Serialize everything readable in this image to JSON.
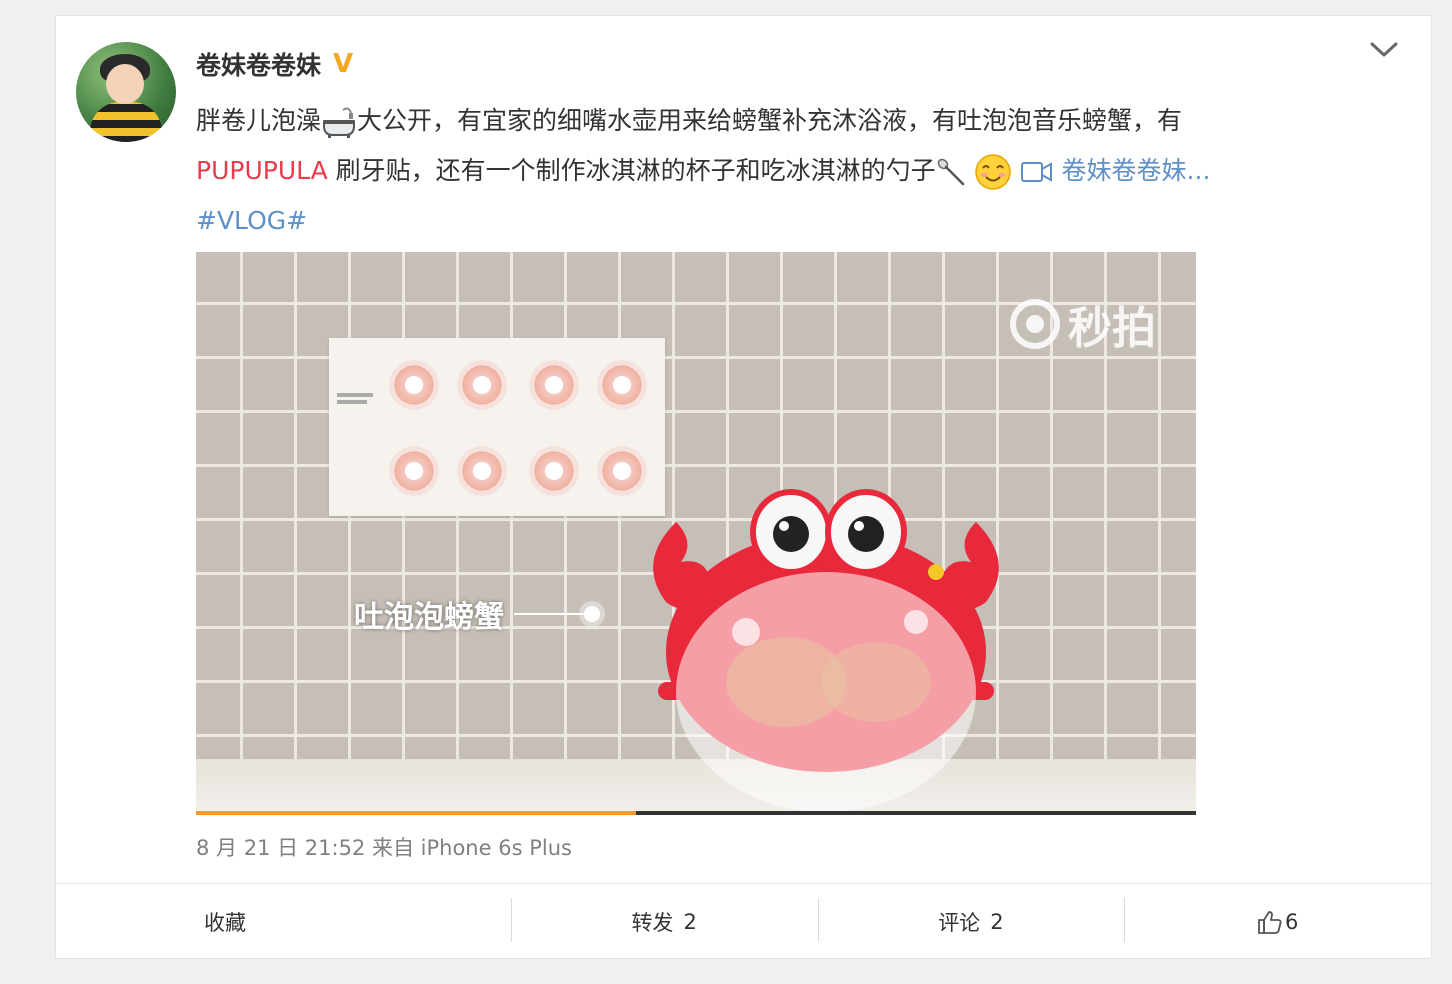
{
  "post": {
    "author": "卷妹卷卷妹",
    "verified_badge": "V",
    "text_part1": "胖卷儿泡澡",
    "text_part2": "大公开，有宜家的细嘴水壶用来给螃蟹补充沐浴液，有吐泡泡音乐螃蟹，有",
    "brand_link": "PUPUPULA",
    "text_part3": " 刷牙贴，还有一个制作冰淇淋的杯子和吃冰淇淋的勺子",
    "video_link": "卷妹卷卷妹...",
    "hashtag": "#VLOG#",
    "timestamp": "8 月 21 日 21:52 来自 iPhone 6s Plus",
    "icons": [
      "bathtub-icon",
      "spoon-icon",
      "smile-emoji-icon",
      "video-camera-icon",
      "chevron-down-icon",
      "thumbs-up-icon"
    ]
  },
  "video": {
    "watermark": "秒拍",
    "caption": "吐泡泡螃蟹",
    "progress": 0.44,
    "accent_color": "#f29a2e"
  },
  "actions": {
    "favorite": "收藏",
    "repost_label": "转发",
    "repost_count": "2",
    "comment_label": "评论",
    "comment_count": "2",
    "like_count": "6"
  },
  "colors": {
    "brand_red": "#e63c4c",
    "link_blue": "#5d8fc8",
    "meta_gray": "#808080"
  }
}
